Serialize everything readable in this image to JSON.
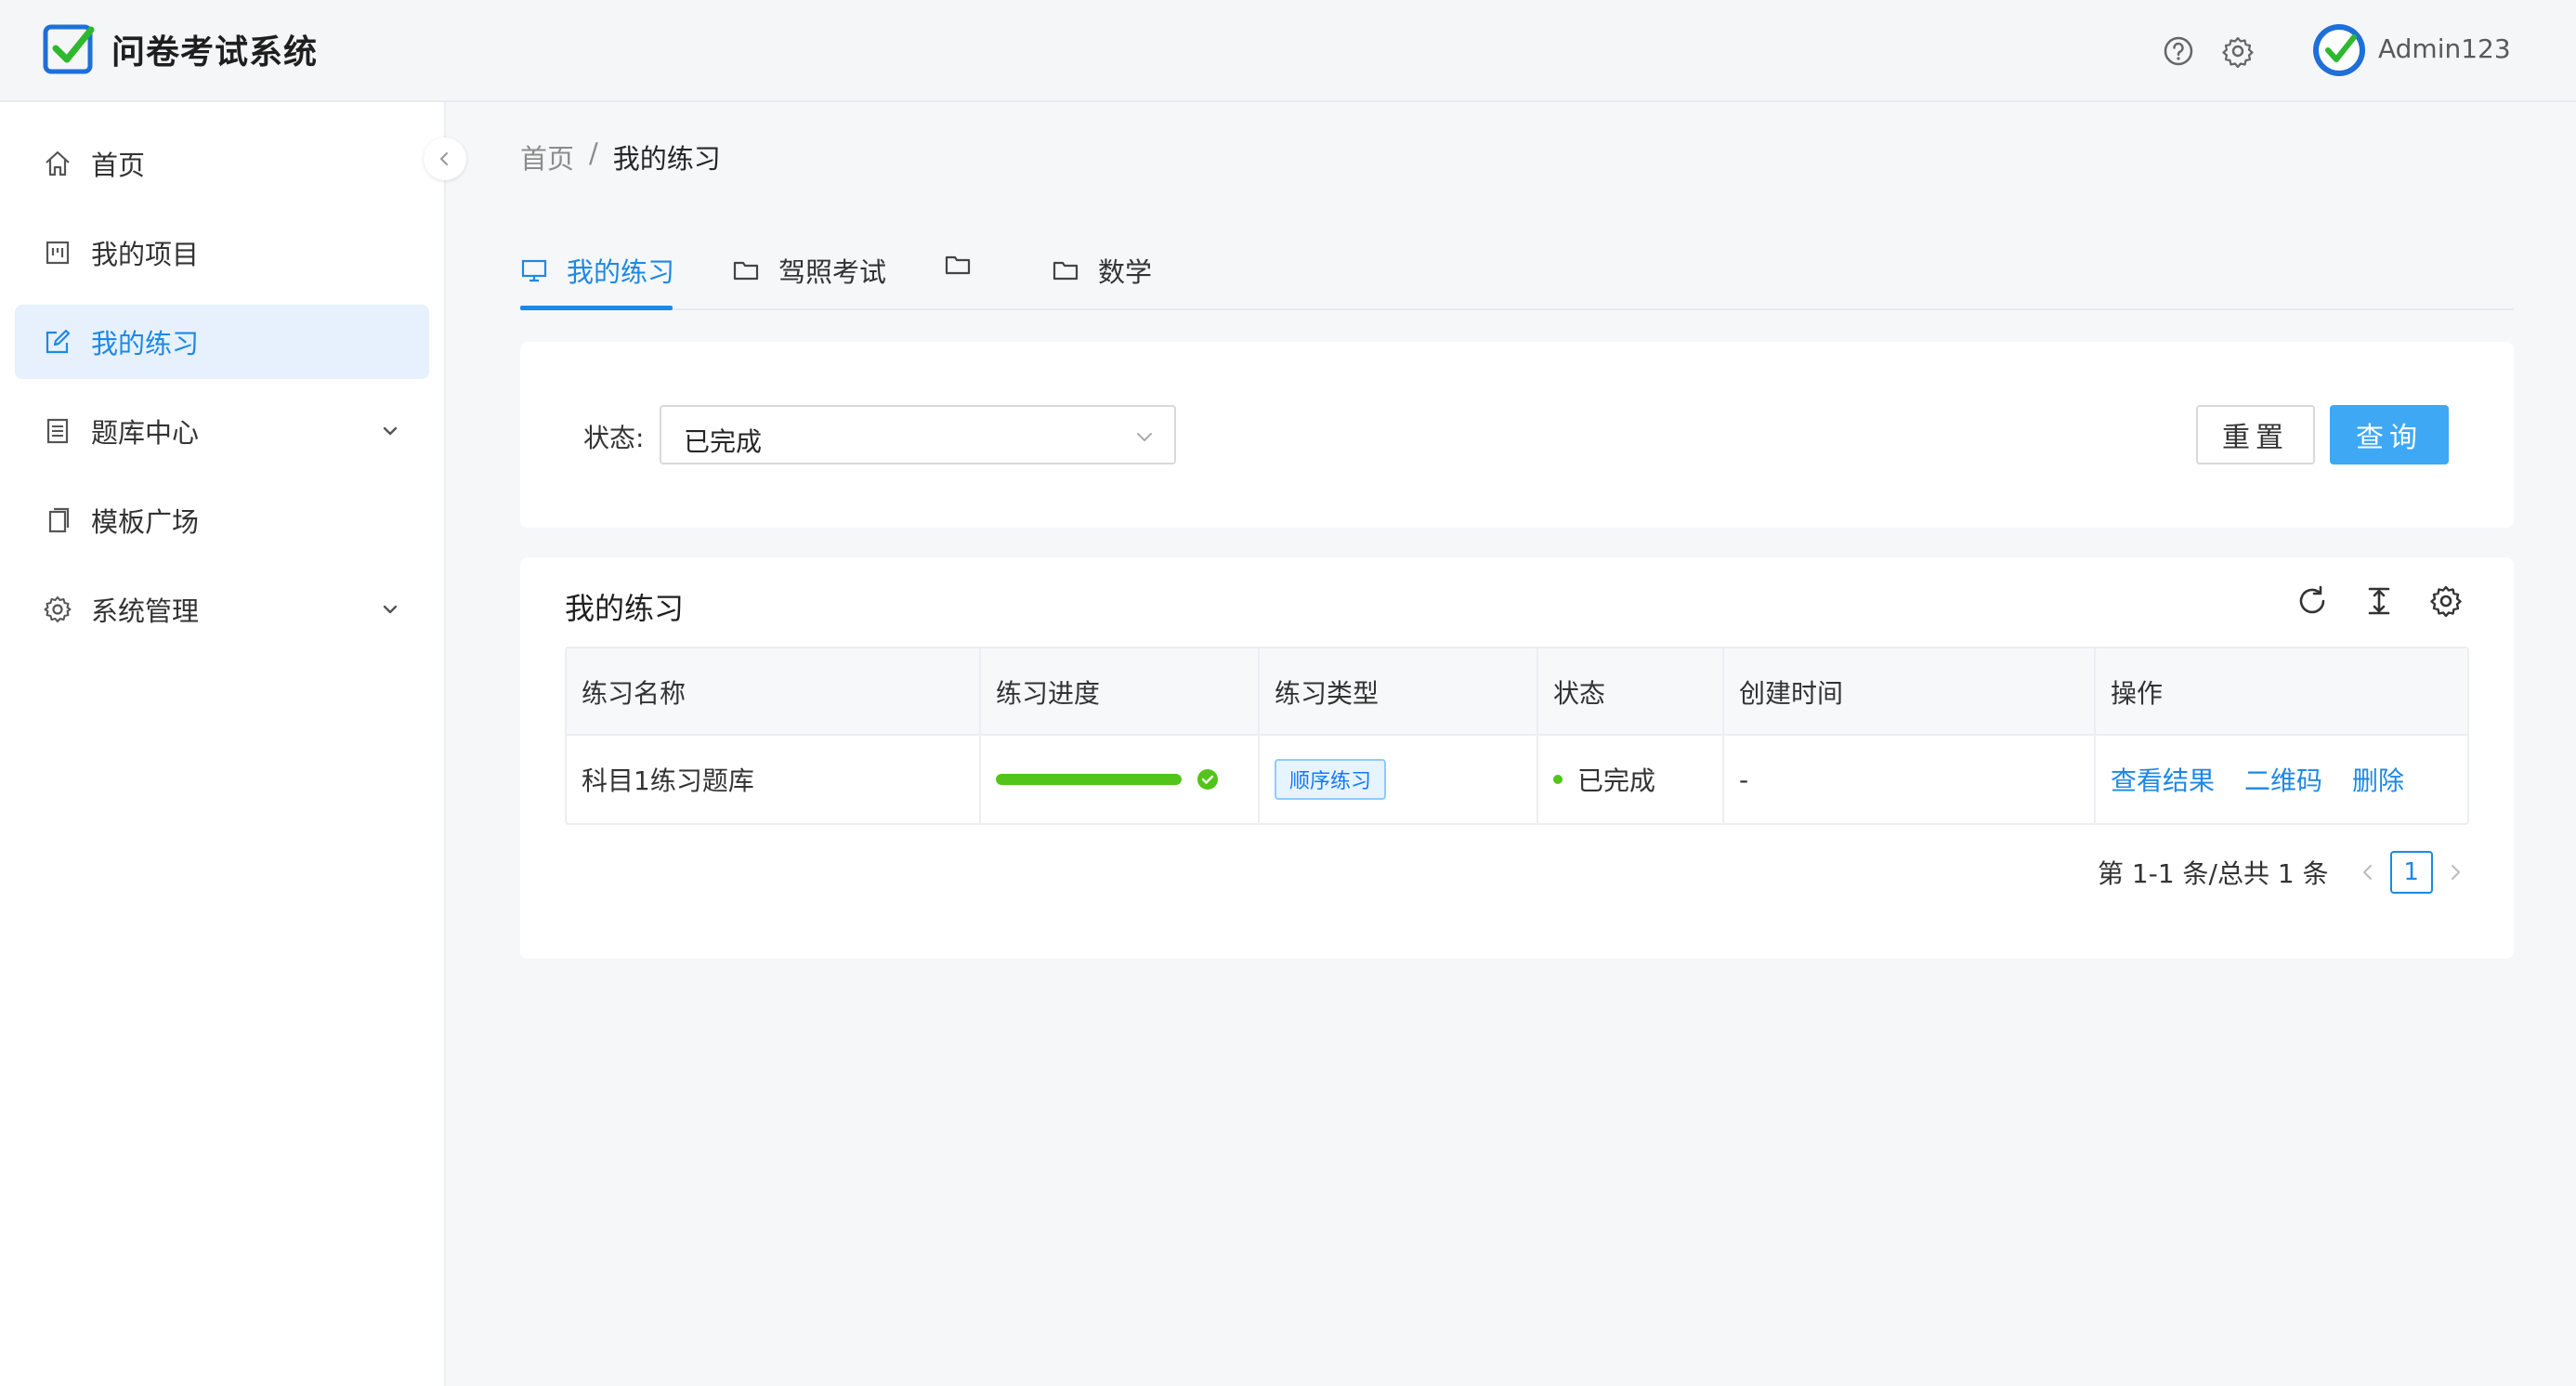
{
  "header": {
    "app_title": "问卷考试系统",
    "username": "Admin123",
    "icons": [
      "help-icon",
      "settings-icon"
    ]
  },
  "sidebar": {
    "items": [
      {
        "label": "首页",
        "icon": "home-icon"
      },
      {
        "label": "我的项目",
        "icon": "project-icon"
      },
      {
        "label": "我的练习",
        "icon": "edit-icon",
        "active": true
      },
      {
        "label": "题库中心",
        "icon": "question-bank-icon",
        "expandable": true
      },
      {
        "label": "模板广场",
        "icon": "template-icon"
      },
      {
        "label": "系统管理",
        "icon": "gear-icon",
        "expandable": true
      }
    ]
  },
  "breadcrumb": {
    "home": "首页",
    "separator": "/",
    "current": "我的练习"
  },
  "tabs": [
    {
      "label": "我的练习",
      "icon": "monitor-icon",
      "active": true
    },
    {
      "label": "驾照考试",
      "icon": "folder-icon"
    },
    {
      "label": "",
      "icon": "folder-icon"
    },
    {
      "label": "数学",
      "icon": "folder-icon"
    }
  ],
  "filter": {
    "status_label": "状态:",
    "status_value": "已完成",
    "reset_label": "重置",
    "query_label": "查询"
  },
  "table": {
    "title": "我的练习",
    "columns": [
      "练习名称",
      "练习进度",
      "练习类型",
      "状态",
      "创建时间",
      "操作"
    ],
    "rows": [
      {
        "name": "科目1练习题库",
        "progress": 1.0,
        "type": "顺序练习",
        "status": "已完成",
        "created": "-",
        "actions": [
          "查看结果",
          "二维码",
          "删除"
        ]
      }
    ]
  },
  "pagination": {
    "summary": "第 1-1 条/总共 1 条",
    "current_page": "1"
  },
  "colors": {
    "primary": "#1e88e5",
    "success": "#52c41a",
    "query_button": "#3ea8f5"
  }
}
